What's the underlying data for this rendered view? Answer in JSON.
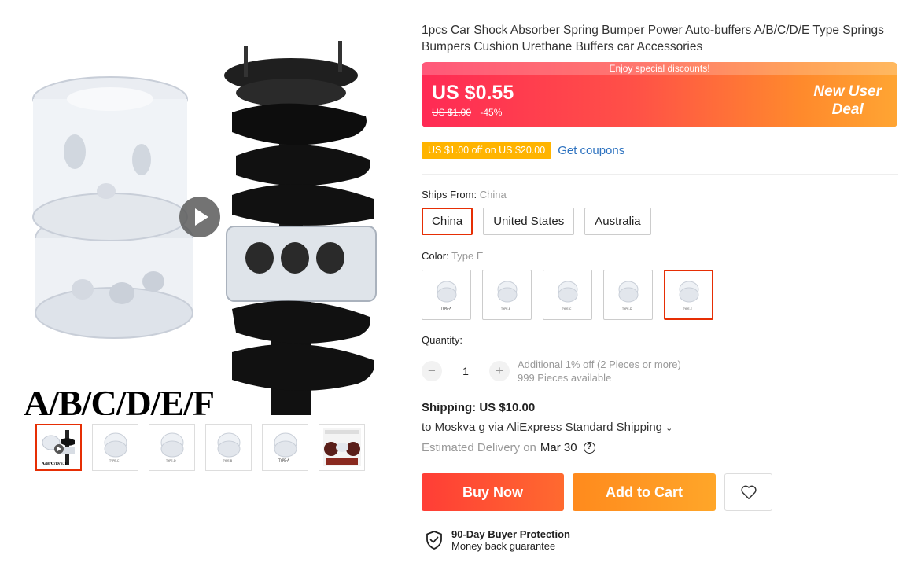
{
  "product": {
    "title": "1pcs Car Shock Absorber Spring Bumper Power Auto-buffers A/B/C/D/E Type Springs Bumpers Cushion Urethane Buffers car Accessories",
    "image_caption": "A/B/C/D/E/F",
    "video_icon": "play-icon"
  },
  "thumbnails": [
    {
      "label": "A/B/C/D/E/F",
      "active": true
    },
    {
      "label": "TYPE-C",
      "active": false
    },
    {
      "label": "TYPE-D",
      "active": false
    },
    {
      "label": "TYPE-B",
      "active": false
    },
    {
      "label": "TYPE-A",
      "active": false
    },
    {
      "label": "",
      "active": false
    }
  ],
  "price": {
    "promo_strip": "Enjoy special discounts!",
    "current": "US $0.55",
    "original": "US $1.00",
    "discount": "-45%",
    "deal_line1": "New User",
    "deal_line2": "Deal"
  },
  "coupon": {
    "tag": "US $1.00 off on US $20.00",
    "link": "Get coupons"
  },
  "ships_from": {
    "label": "Ships From:",
    "selected": "China",
    "options": [
      "China",
      "United States",
      "Australia"
    ]
  },
  "color": {
    "label": "Color:",
    "selected": "Type E",
    "options": [
      "TYPE-A",
      "TYPE-B",
      "TYPE-C",
      "TYPE-D",
      "TYPE-E"
    ]
  },
  "quantity": {
    "label": "Quantity:",
    "value": "1",
    "minus": "−",
    "plus": "+",
    "note1": "Additional 1% off (2 Pieces or more)",
    "note2": "999 Pieces available"
  },
  "shipping": {
    "title": "Shipping: US $10.00",
    "to": "to Moskva g via AliExpress Standard Shipping",
    "est_label": "Estimated Delivery on",
    "est_date": "Mar 30",
    "help": "?"
  },
  "actions": {
    "buy": "Buy Now",
    "cart": "Add to Cart",
    "wishlist_icon": "heart-icon"
  },
  "protection": {
    "title": "90-Day Buyer Protection",
    "subtitle": "Money back guarantee",
    "icon": "shield-check-icon"
  },
  "colors": {
    "accent": "#e62e04",
    "coupon": "#ffb400",
    "link": "#2e73c0"
  }
}
